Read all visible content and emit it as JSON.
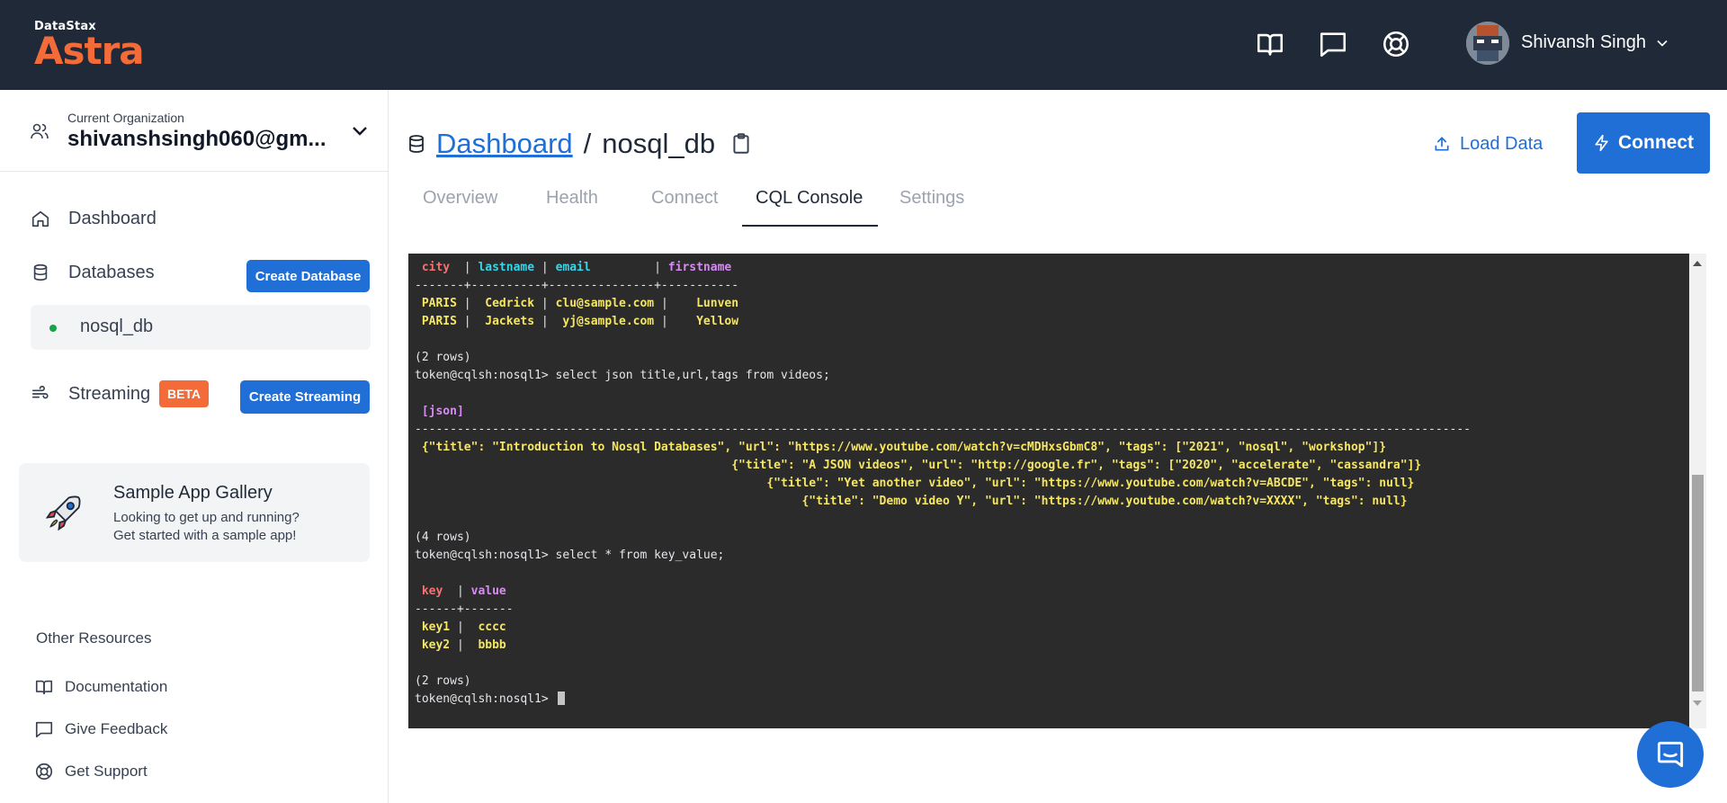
{
  "header": {
    "logo_small": "DataStax",
    "logo_big": "Astra",
    "user_name": "Shivansh Singh"
  },
  "sidebar": {
    "org_label": "Current Organization",
    "org_value": "shivanshsingh060@gm...",
    "dashboard_label": "Dashboard",
    "databases_label": "Databases",
    "create_database_label": "Create Database",
    "db_name": "nosql_db",
    "streaming_label": "Streaming",
    "beta_label": "BETA",
    "create_streaming_label": "Create Streaming",
    "gallery": {
      "title": "Sample App Gallery",
      "line1": "Looking to get up and running?",
      "line2": "Get started with a sample app!"
    },
    "resources_title": "Other Resources",
    "resources": {
      "documentation": "Documentation",
      "feedback": "Give Feedback",
      "support": "Get Support"
    }
  },
  "main": {
    "breadcrumb_link": "Dashboard",
    "breadcrumb_sep": "/",
    "db_name": "nosql_db",
    "load_data_label": "Load Data",
    "connect_label": "Connect",
    "tabs": {
      "overview": "Overview",
      "health": "Health",
      "connect": "Connect",
      "cql_console": "CQL Console",
      "settings": "Settings"
    },
    "active_tab": "CQL Console"
  },
  "terminal": {
    "lines": [
      [
        {
          "t": " "
        },
        {
          "t": "city",
          "c": "red"
        },
        {
          "t": "  | "
        },
        {
          "t": "lastname",
          "c": "cyan"
        },
        {
          "t": " | "
        },
        {
          "t": "email",
          "c": "cyan"
        },
        {
          "t": "         | "
        },
        {
          "t": "firstname",
          "c": "mag"
        }
      ],
      [
        {
          "t": "-------+----------+---------------+-----------"
        }
      ],
      [
        {
          "t": " PARIS",
          "c": "yel"
        },
        {
          "t": " |  "
        },
        {
          "t": "Cedrick",
          "c": "yel"
        },
        {
          "t": " | "
        },
        {
          "t": "clu@sample.com",
          "c": "yel"
        },
        {
          "t": " |    "
        },
        {
          "t": "Lunven",
          "c": "yel"
        }
      ],
      [
        {
          "t": " PARIS",
          "c": "yel"
        },
        {
          "t": " |  "
        },
        {
          "t": "Jackets",
          "c": "yel"
        },
        {
          "t": " |  "
        },
        {
          "t": "yj@sample.com",
          "c": "yel"
        },
        {
          "t": " |    "
        },
        {
          "t": "Yellow",
          "c": "yel"
        }
      ],
      [
        {
          "t": ""
        }
      ],
      [
        {
          "t": "(2 rows)"
        }
      ],
      [
        {
          "t": "token@cqlsh:nosql1> select json title,url,tags from videos;"
        }
      ],
      [
        {
          "t": ""
        }
      ],
      [
        {
          "t": " "
        },
        {
          "t": "[json]",
          "c": "mag"
        }
      ],
      [
        {
          "t": "------------------------------------------------------------------------------------------------------------------------------------------------------"
        }
      ],
      [
        {
          "t": " {\"title\": \"Introduction to Nosql Databases\", \"url\": \"https://www.youtube.com/watch?v=cMDHxsGbmC8\", \"tags\": [\"2021\", \"nosql\", \"workshop\"]}",
          "c": "yel"
        }
      ],
      [
        {
          "t": "                                             {\"title\": \"A JSON videos\", \"url\": \"http://google.fr\", \"tags\": [\"2020\", \"accelerate\", \"cassandra\"]}",
          "c": "yel"
        }
      ],
      [
        {
          "t": "                                                  {\"title\": \"Yet another video\", \"url\": \"https://www.youtube.com/watch?v=ABCDE\", \"tags\": null}",
          "c": "yel"
        }
      ],
      [
        {
          "t": "                                                       {\"title\": \"Demo video Y\", \"url\": \"https://www.youtube.com/watch?v=XXXX\", \"tags\": null}",
          "c": "yel"
        }
      ],
      [
        {
          "t": ""
        }
      ],
      [
        {
          "t": "(4 rows)"
        }
      ],
      [
        {
          "t": "token@cqlsh:nosql1> select * from key_value;"
        }
      ],
      [
        {
          "t": ""
        }
      ],
      [
        {
          "t": " "
        },
        {
          "t": "key",
          "c": "red"
        },
        {
          "t": "  | "
        },
        {
          "t": "value",
          "c": "mag"
        }
      ],
      [
        {
          "t": "------+-------"
        }
      ],
      [
        {
          "t": " "
        },
        {
          "t": "key1",
          "c": "yel"
        },
        {
          "t": " |  "
        },
        {
          "t": "cccc",
          "c": "yel"
        }
      ],
      [
        {
          "t": " "
        },
        {
          "t": "key2",
          "c": "yel"
        },
        {
          "t": " |  "
        },
        {
          "t": "bbbb",
          "c": "yel"
        }
      ],
      [
        {
          "t": ""
        }
      ],
      [
        {
          "t": "(2 rows)"
        }
      ]
    ],
    "prompt": "token@cqlsh:nosql1> ",
    "colors": {
      "red": "#f87171",
      "cyan": "#38d6e8",
      "mag": "#d68cf0",
      "yel": "#f5e663",
      "white": "#e5e7eb"
    }
  },
  "colors": {
    "topbar": "#1f2937",
    "accent": "#1f6fd6",
    "brand": "#f26b38",
    "terminal_bg": "#2b2b2b"
  },
  "icons": {
    "docs": "book-icon",
    "chat": "chat-icon",
    "support": "lifebuoy-icon"
  }
}
